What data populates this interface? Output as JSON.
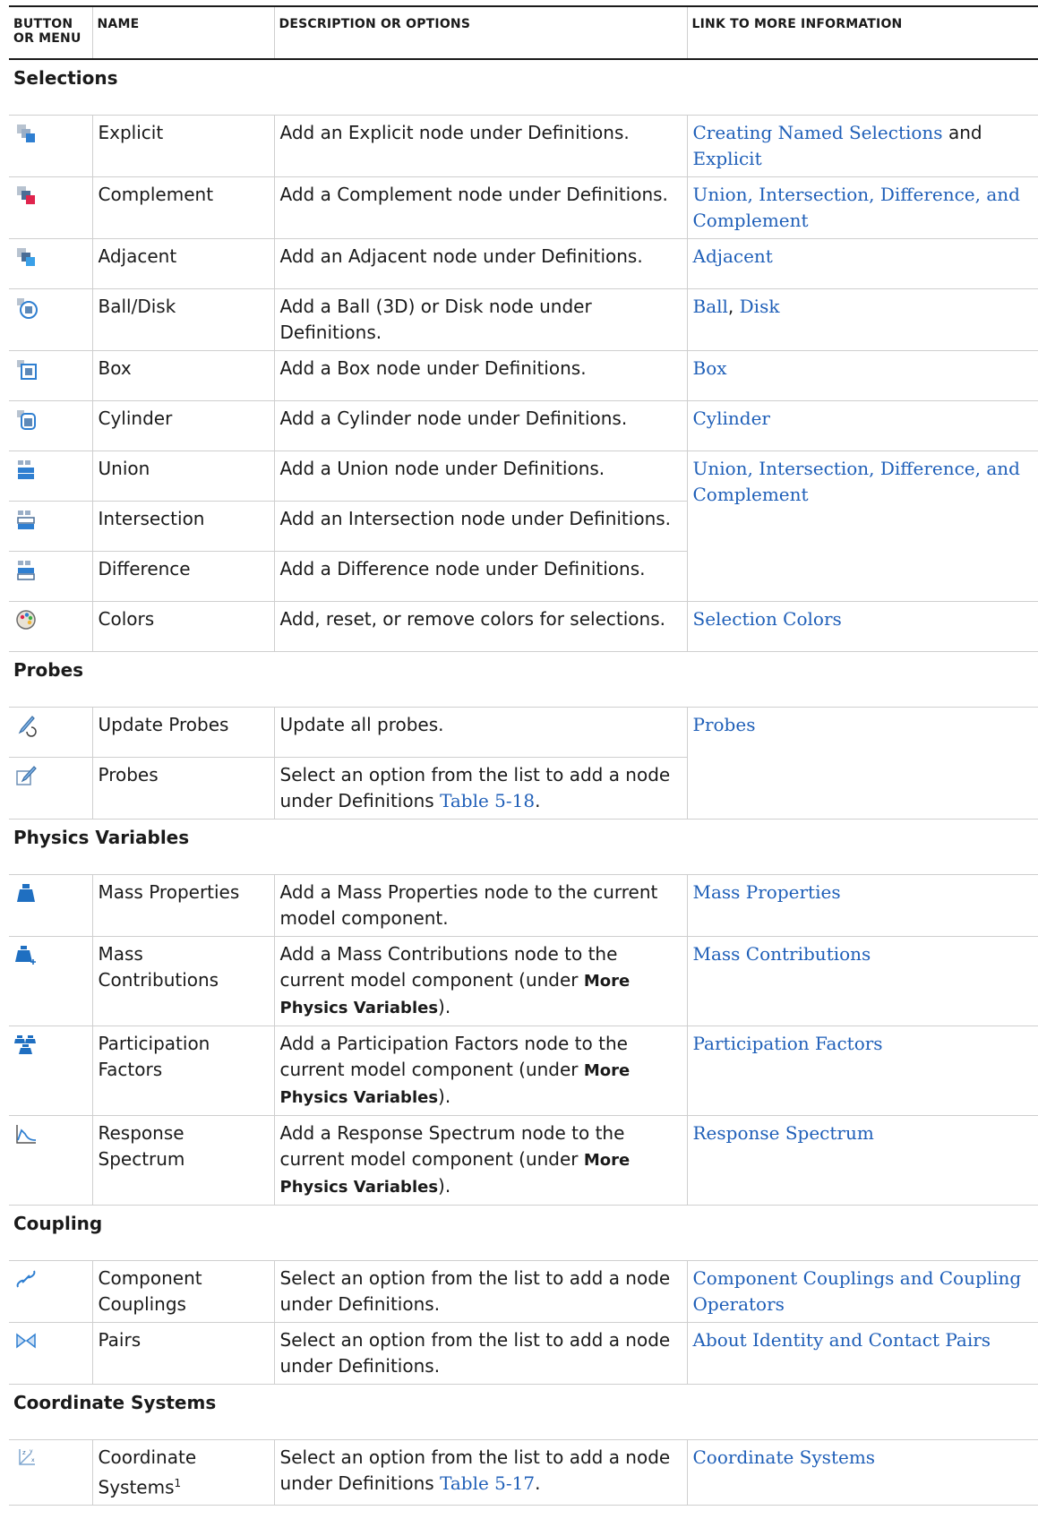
{
  "headers": {
    "button": "BUTTON OR MENU",
    "name": "NAME",
    "description": "DESCRIPTION OR OPTIONS",
    "link": "LINK TO MORE INFORMATION"
  },
  "sections": {
    "selections": "Selections",
    "probes": "Probes",
    "physics": "Physics Variables",
    "coupling": "Coupling",
    "coords": "Coordinate Systems"
  },
  "rows": {
    "explicit": {
      "name": "Explicit",
      "desc": "Add an Explicit node under Definitions.",
      "link1": "Creating Named Selections",
      "and": "and",
      "link2": "Explicit",
      "icon": "explicit-selection-icon"
    },
    "complement": {
      "name": "Complement",
      "desc": "Add a Complement node under Definitions.",
      "link": "Union, Intersection, Difference, and Complement",
      "icon": "complement-selection-icon"
    },
    "adjacent": {
      "name": "Adjacent",
      "desc": "Add an Adjacent node under Definitions.",
      "link": "Adjacent",
      "icon": "adjacent-selection-icon"
    },
    "ball": {
      "name": "Ball/Disk",
      "desc": "Add a Ball (3D) or Disk node under Definitions.",
      "link1": "Ball",
      "sep": ",",
      "link2": "Disk",
      "icon": "ball-disk-selection-icon"
    },
    "box": {
      "name": "Box",
      "desc": "Add a Box node under Definitions.",
      "link": "Box",
      "icon": "box-selection-icon"
    },
    "cylinder": {
      "name": "Cylinder",
      "desc": "Add a Cylinder node under Definitions.",
      "link": "Cylinder",
      "icon": "cylinder-selection-icon"
    },
    "union": {
      "name": "Union",
      "desc": "Add a Union node under Definitions.",
      "link": "Union, Intersection, Difference, and Complement",
      "icon": "union-selection-icon"
    },
    "intersection": {
      "name": "Intersection",
      "desc": "Add an Intersection node under Definitions.",
      "icon": "intersection-selection-icon"
    },
    "difference": {
      "name": "Difference",
      "desc": "Add a Difference node under Definitions.",
      "icon": "difference-selection-icon"
    },
    "colors": {
      "name": "Colors",
      "desc": "Add, reset, or remove colors for selections.",
      "link": "Selection Colors",
      "icon": "palette-icon"
    },
    "update_probes": {
      "name": "Update Probes",
      "desc": "Update all probes.",
      "link": "Probes",
      "icon": "update-probes-icon"
    },
    "probes": {
      "name": "Probes",
      "desc": "Select an option from the list to add a node under Definitions",
      "desc_ref": "Table 5-18",
      "desc_end": ".",
      "icon": "probes-icon"
    },
    "mass_properties": {
      "name": "Mass Properties",
      "desc": "Add a Mass Properties node to the current model component.",
      "link": "Mass Properties",
      "icon": "mass-properties-icon"
    },
    "mass_contributions": {
      "name": "Mass Contributions",
      "desc": "Add a Mass Contributions node to the current model component (under",
      "bold": "More Physics Variables",
      "desc_end": ").",
      "link": "Mass Contributions",
      "icon": "mass-contributions-icon"
    },
    "participation": {
      "name": "Participation Factors",
      "desc": "Add a Participation Factors node to the current model component (under",
      "bold": "More Physics Variables",
      "desc_end": ").",
      "link": "Participation Factors",
      "icon": "participation-factors-icon"
    },
    "response": {
      "name": "Response Spectrum",
      "desc": "Add a Response Spectrum node to the current model component (under",
      "bold": "More Physics Variables",
      "desc_end": ").",
      "link": "Response Spectrum",
      "icon": "response-spectrum-icon"
    },
    "component_couplings": {
      "name": "Component Couplings",
      "desc": "Select an option from the list to add a node under Definitions.",
      "link": "Component Couplings and Coupling Operators",
      "icon": "component-couplings-icon"
    },
    "pairs": {
      "name": "Pairs",
      "desc": "Select an option from the list to add a node under Definitions.",
      "link": "About Identity and Contact Pairs",
      "icon": "pairs-icon"
    },
    "coordinate_systems": {
      "name": "Coordinate Systems",
      "sup": "1",
      "desc": "Select an option from the list to add a node under Definitions",
      "desc_ref": "Table 5-17",
      "desc_end": ".",
      "link": "Coordinate Systems",
      "icon": "coordinate-systems-icon"
    }
  },
  "colors": {
    "link": "#1f5fb8",
    "rule": "#cfcfcf"
  }
}
